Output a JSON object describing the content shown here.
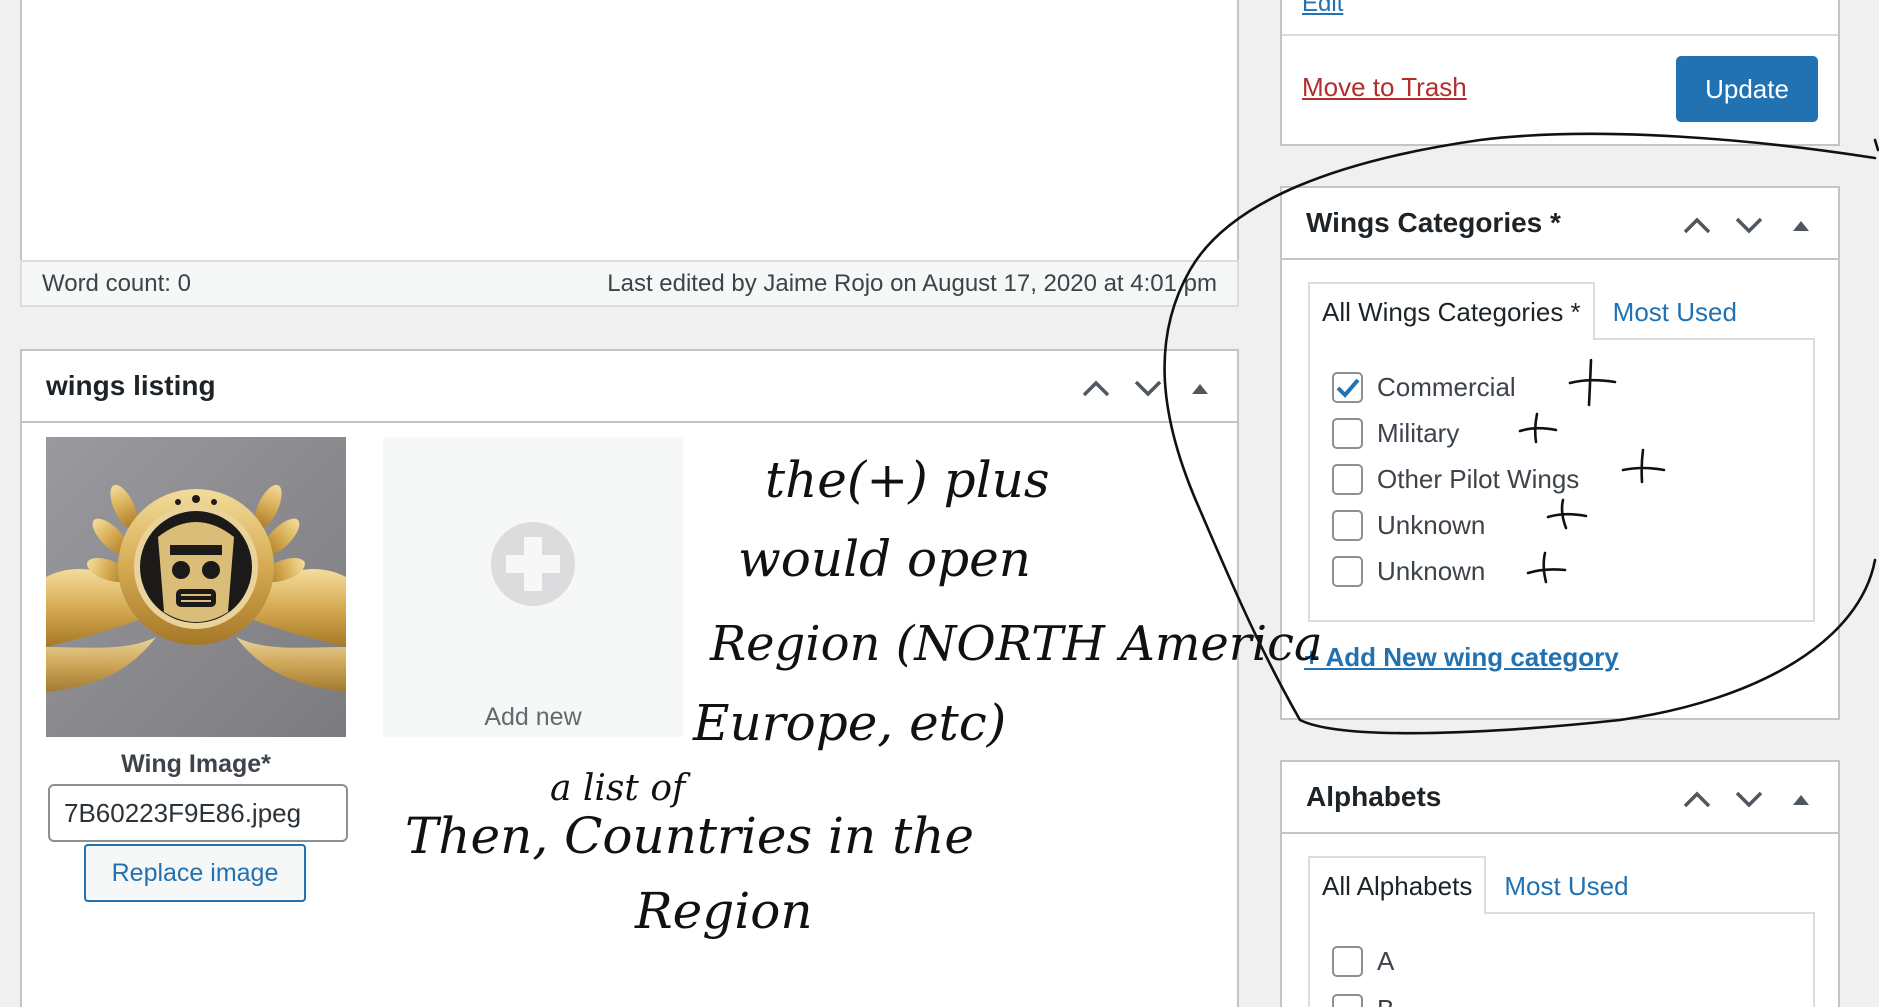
{
  "editor": {
    "word_count": "Word count: 0",
    "last_edited": "Last edited by Jaime Rojo on August 17, 2020 at 4:01 pm"
  },
  "wings_listing": {
    "title": "wings listing",
    "image_label": "Wing Image*",
    "file_name": "7B60223F9E86.jpeg",
    "replace_button": "Replace image",
    "add_new": "Add new"
  },
  "publish": {
    "edit_link": "Edit",
    "trash_link": "Move to Trash",
    "update_button": "Update"
  },
  "wing_categories": {
    "title": "Wings Categories *",
    "tabs": [
      "All Wings Categories *",
      "Most Used"
    ],
    "items": [
      {
        "label": "Commercial",
        "checked": true
      },
      {
        "label": "Military",
        "checked": false
      },
      {
        "label": "Other Pilot Wings",
        "checked": false
      },
      {
        "label": "Unknown",
        "checked": false
      },
      {
        "label": "Unknown",
        "checked": false
      }
    ],
    "add_new_link": "+ Add New wing category"
  },
  "alphabets": {
    "title": "Alphabets",
    "tabs": [
      "All Alphabets",
      "Most Used"
    ],
    "items": [
      {
        "label": "A",
        "checked": false
      },
      {
        "label": "B",
        "checked": false
      }
    ]
  },
  "handwritten_note": {
    "lines": [
      "the(+) plus",
      "would open",
      "Region (NORTH America",
      "Europe, etc)",
      "a list of",
      "Then, Countries in the",
      "Region"
    ],
    "markers": [
      "+",
      "+",
      "+",
      "+",
      "+"
    ]
  },
  "colors": {
    "link": "#2271b1",
    "danger": "#b32d2e",
    "primary_button": "#2271b1",
    "border": "#c3c4c7",
    "background": "#f0f0f1",
    "ink": "#111111"
  },
  "icons": {
    "move_up": "chevron-up-icon",
    "move_down": "chevron-down-icon",
    "toggle": "caret-up-icon",
    "add": "plus-circle-icon",
    "checked": "checkmark-icon"
  }
}
